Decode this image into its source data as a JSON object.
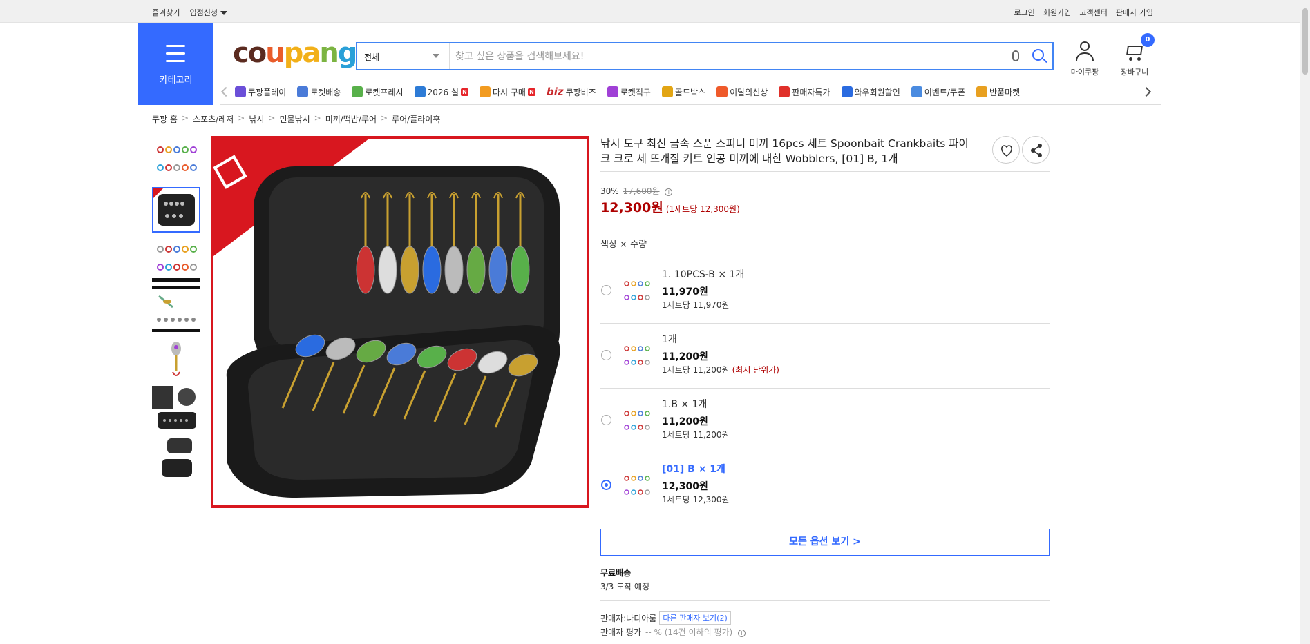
{
  "topbar": {
    "favorites": "즐겨찾기",
    "partner": "입점신청",
    "login": "로그인",
    "signup": "회원가입",
    "support": "고객센터",
    "seller_join": "판매자 가입"
  },
  "header": {
    "category_label": "카테고리",
    "logo": {
      "c1": "co",
      "c2": "u",
      "c3": "pa",
      "c4": "n",
      "c5": "g"
    },
    "search_category": "전체",
    "search_placeholder": "찾고 싶은 상품을 검색해보세요!",
    "mycoupang": "마이쿠팡",
    "cart": "장바구니",
    "cart_count": "0"
  },
  "catnav": [
    {
      "label": "쿠팡플레이",
      "color": "#6b4fd8"
    },
    {
      "label": "로켓배송",
      "color": "#4a7bd8"
    },
    {
      "label": "로켓프레시",
      "color": "#58b04a"
    },
    {
      "label": "2026 설",
      "color": "#2d7bd6",
      "new": true
    },
    {
      "label": "다시 구매",
      "color": "#f29b20",
      "new": true
    },
    {
      "label": "쿠팡비즈",
      "color": "#c8282b",
      "prefix": "biz"
    },
    {
      "label": "로켓직구",
      "color": "#a040d6"
    },
    {
      "label": "골드박스",
      "color": "#e2a514"
    },
    {
      "label": "이달의신상",
      "color": "#ef5a2a"
    },
    {
      "label": "판매자특가",
      "color": "#e0302a"
    },
    {
      "label": "와우회원할인",
      "color": "#2a6be0"
    },
    {
      "label": "이벤트/쿠폰",
      "color": "#4a8be0"
    },
    {
      "label": "반품마켓",
      "color": "#e8a020"
    }
  ],
  "catnav_new": "N",
  "catnav_biz": "biz",
  "breadcrumb": [
    "쿠팡 홈",
    "스포츠/레저",
    "낚시",
    "민물낚시",
    "미끼/떡밥/루어",
    "루어/플라이훅"
  ],
  "breadcrumb_sep": ">",
  "product": {
    "title": "낚시 도구 최신 금속 스푼 스피너 미끼 16pcs 세트 Spoonbait Crankbaits 파이크 크로 세 뜨개질 키트 인공 미끼에 대한 Wobblers, [01] B, 1개",
    "discount": "30%",
    "original_price": "17,600원",
    "price": "12,300원",
    "unit_price": "(1세트당 12,300원)",
    "option_label": "색상 × 수량",
    "info_glyph": "i"
  },
  "options": [
    {
      "name": "1. 10PCS-B × 1개",
      "price": "11,970원",
      "unit": "1세트당 11,970원",
      "lowest": "",
      "selected": false
    },
    {
      "name": "1개",
      "price": "11,200원",
      "unit": "1세트당 11,200원",
      "lowest": "(최저 단위가)",
      "selected": false
    },
    {
      "name": "1.B × 1개",
      "price": "11,200원",
      "unit": "1세트당 11,200원",
      "lowest": "",
      "selected": false
    },
    {
      "name": "[01] B × 1개",
      "price": "12,300원",
      "unit": "1세트당 12,300원",
      "lowest": "",
      "selected": true
    }
  ],
  "all_options": "모든 옵션 보기 >",
  "shipping": {
    "label": "무료배송",
    "eta": "3/3 도착 예정"
  },
  "seller": {
    "label": "판매자:나디아룸",
    "other": "다른 판매자 보기(2)"
  },
  "rating": {
    "label": "판매자 평가",
    "value": "-- % (14건 이하의 평가)"
  }
}
